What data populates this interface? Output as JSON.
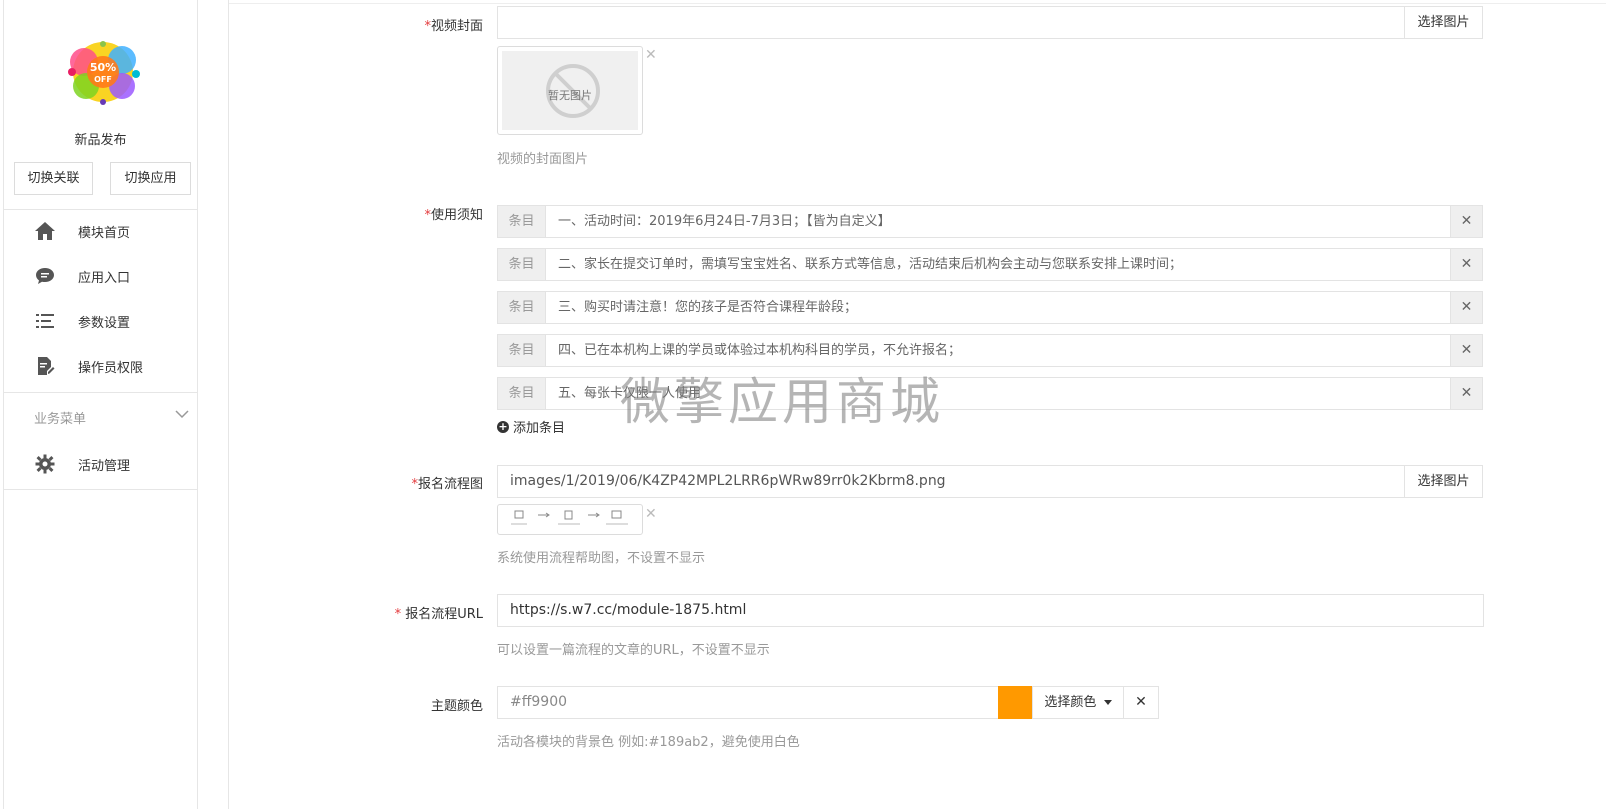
{
  "sidebar": {
    "app_name": "新品发布",
    "switch_link_label": "切换关联",
    "switch_app_label": "切换应用",
    "items": [
      {
        "label": "模块首页",
        "icon": "home-icon"
      },
      {
        "label": "应用入口",
        "icon": "chat-bubble-icon"
      },
      {
        "label": "参数设置",
        "icon": "list-settings-icon"
      },
      {
        "label": "操作员权限",
        "icon": "document-edit-icon"
      }
    ],
    "group_title": "业务菜单",
    "group_items": [
      {
        "label": "活动管理",
        "icon": "gear-icon"
      }
    ]
  },
  "form": {
    "video_cover": {
      "required": "*",
      "label": "视频封面",
      "value": "",
      "button": "选择图片",
      "thumb_text": "暂无图片",
      "help": "视频的封面图片"
    },
    "notice": {
      "required": "*",
      "label": "使用须知",
      "tag": "条目",
      "items": [
        "一、活动时间：2019年6月24日-7月3日；【皆为自定义】",
        "二、家长在提交订单时，需填写宝宝姓名、联系方式等信息，活动结束后机构会主动与您联系安排上课时间；",
        "三、购买时请注意！您的孩子是否符合课程年龄段；",
        "四、已在本机构上课的学员或体验过本机构科目的学员，不允许报名；",
        "五、每张卡仅限一人使用"
      ],
      "add_label": "添加条目"
    },
    "flow_image": {
      "required": "*",
      "label": "报名流程图",
      "value": "images/1/2019/06/K4ZP42MPL2LRR6pWRw89rr0k2Kbrm8.png",
      "button": "选择图片",
      "help": "系统使用流程帮助图，不设置不显示"
    },
    "flow_url": {
      "required": "*",
      "label": "报名流程URL",
      "value": "https://s.w7.cc/module-1875.html",
      "help": "可以设置一篇流程的文章的URL，不设置不显示"
    },
    "theme_color": {
      "label": "主题颜色",
      "value": "#ff9900",
      "swatch": "#ff9900",
      "button": "选择颜色",
      "help": "活动各模块的背景色 例如:#189ab2，避免使用白色"
    }
  },
  "watermark": "微擎应用商城"
}
